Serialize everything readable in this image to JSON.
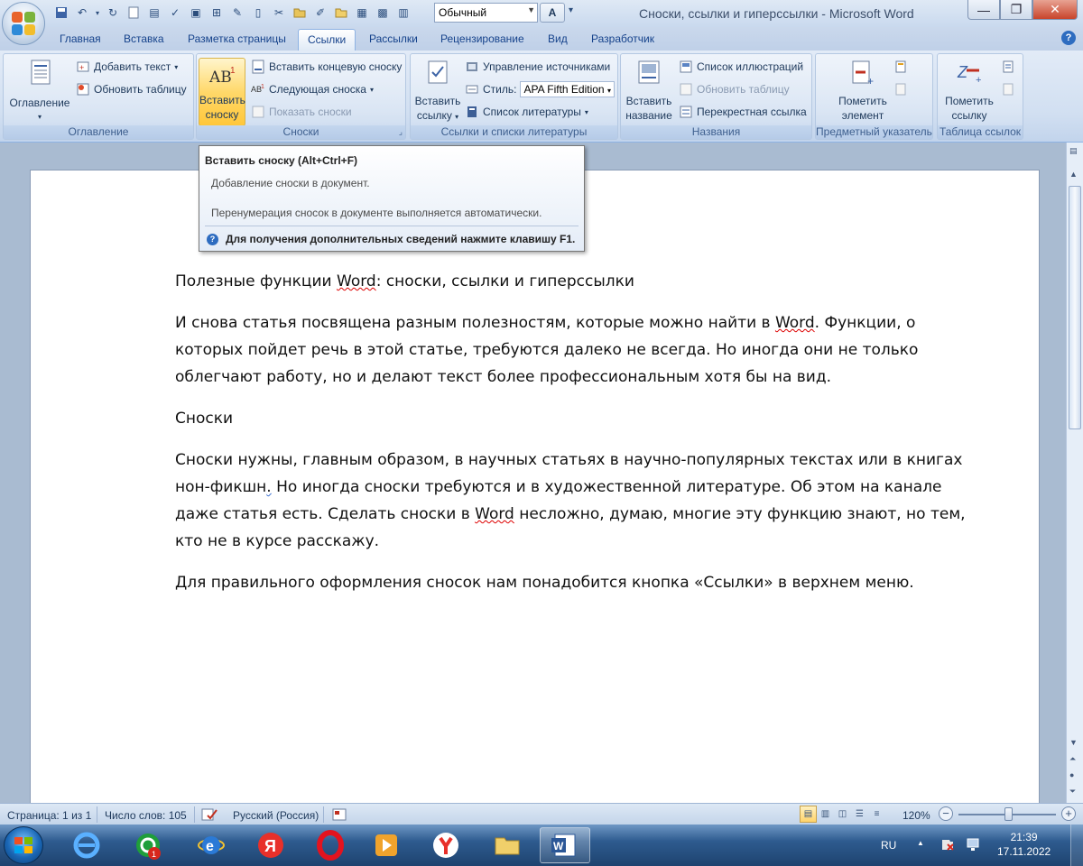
{
  "window": {
    "title": "Сноски, ссылки и гиперссылки - Microsoft Word",
    "style_value": "Обычный",
    "style_quick_label": "A"
  },
  "tabs": [
    "Главная",
    "Вставка",
    "Разметка страницы",
    "Ссылки",
    "Рассылки",
    "Рецензирование",
    "Вид",
    "Разработчик"
  ],
  "active_tab": "Ссылки",
  "ribbon": {
    "toc": {
      "label": "Оглавление",
      "big": "Оглавление",
      "add_text": "Добавить текст",
      "update_table": "Обновить таблицу"
    },
    "footnotes": {
      "label": "Сноски",
      "insert_line1": "Вставить",
      "insert_line2": "сноску",
      "insert_endnote": "Вставить концевую сноску",
      "next_footnote": "Следующая сноска",
      "show_notes": "Показать сноски"
    },
    "citations": {
      "label": "Ссылки и списки литературы",
      "insert_line1": "Вставить",
      "insert_line2": "ссылку",
      "manage_sources": "Управление источниками",
      "style_label": "Стиль:",
      "style_value": "APA Fifth Edition",
      "bibliography": "Список литературы"
    },
    "captions": {
      "label": "Названия",
      "insert_line1": "Вставить",
      "insert_line2": "название",
      "table_of_figures": "Список иллюстраций",
      "update_table": "Обновить таблицу",
      "cross_reference": "Перекрестная ссылка"
    },
    "index": {
      "label": "Предметный указатель",
      "mark_line1": "Пометить",
      "mark_line2": "элемент"
    },
    "toa": {
      "label": "Таблица ссылок",
      "mark_line1": "Пометить",
      "mark_line2": "ссылку"
    }
  },
  "tooltip": {
    "title": "Вставить сноску (Alt+Ctrl+F)",
    "line1": "Добавление сноски в документ.",
    "line2": "Перенумерация сносок в документе выполняется автоматически.",
    "help": "Для получения дополнительных сведений нажмите клавишу F1."
  },
  "document": {
    "p1_a": "Полезные функции ",
    "p1_word": "Word",
    "p1_b": ": сноски, ссылки и гиперссылки",
    "p2_a": "И снова статья посвящена разным полезностям, которые можно найти в ",
    "p2_word": "Word",
    "p2_b": ".  Функции, о которых пойдет речь в этой статье, требуются далеко не всегда. Но иногда они не только облегчают работу, но и делают текст более профессиональным хотя бы на вид.",
    "p3": "Сноски",
    "p4_a": "Сноски нужны, главным образом,  в научных статьях в научно-популярных текстах или в книгах нон-фикшн",
    "p4_dot": ".",
    "p4_b": " Но иногда сноски требуются и в художественной литературе. Об этом на канале даже статья есть. Сделать сноски в ",
    "p4_word": "Word",
    "p4_c": " несложно, думаю, многие эту функцию знают, но тем, кто не в курсе расскажу.",
    "p5": "Для правильного оформления сносок нам понадобится кнопка «Ссылки» в верхнем меню."
  },
  "statusbar": {
    "page": "Страница: 1 из 1",
    "words": "Число слов: 105",
    "language": "Русский (Россия)",
    "zoom": "120%",
    "zoom_level_percent": 120
  },
  "taskbar": {
    "lang": "RU",
    "time": "21:39",
    "date": "17.11.2022",
    "badge": "1",
    "apps": [
      "start-orb",
      "internet-explorer-icon",
      "messenger-icon",
      "internet-explorer-alt-icon",
      "yandex-icon",
      "opera-icon",
      "media-player-icon",
      "yandex-browser-icon",
      "file-explorer-icon",
      "word-icon"
    ]
  },
  "colors": {
    "ribbon_bg": "#d1dff1",
    "highlight": "#ffd36b",
    "spellcheck": "#d00000",
    "taskbar": "#2e5b8f"
  }
}
